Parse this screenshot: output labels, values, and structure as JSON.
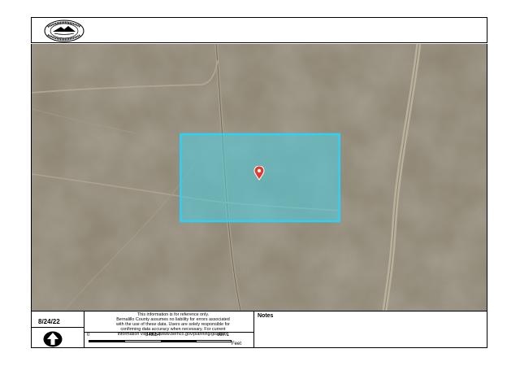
{
  "header": {
    "seal_label": "Bernalillo County seal",
    "seal_text_top": "BERNALILLO COUNTY",
    "seal_text_bottom": "STATE OF NEW MEXICO"
  },
  "map": {
    "imagery": "aerial-desert-terrain",
    "parcel_highlight_color": "#3fd3f0",
    "marker_icon": "map-pin-icon",
    "marker_color": "#e03a2f"
  },
  "footer": {
    "date": "8/24/22",
    "north_arrow_icon": "north-arrow-icon",
    "disclaimer_lines": [
      "This information is for reference only.",
      "Bernalillo County assumes no liability for errors associated",
      "with the use of these data. Users are solely responsible for",
      "confirming data accuracy when necessary. For current",
      "information visit http://www.bernco.gov/planning/gis.aspx."
    ],
    "scale": {
      "labels": [
        "0",
        "348.54",
        "697.1"
      ],
      "unit": "Feet"
    },
    "notes_title": "Notes"
  }
}
